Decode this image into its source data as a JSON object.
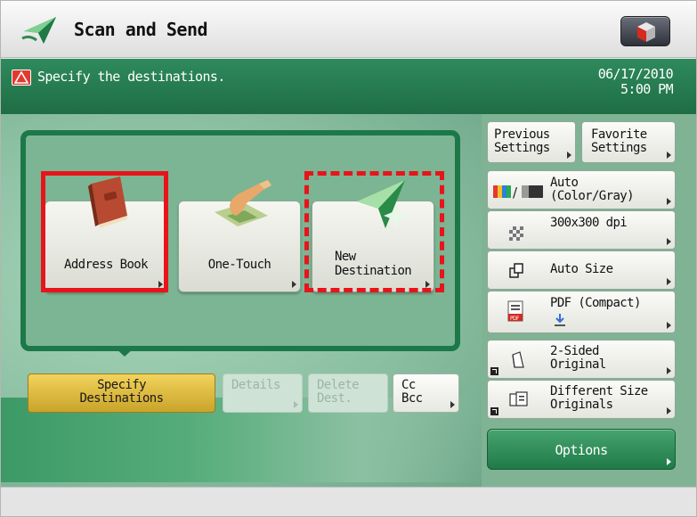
{
  "app": {
    "title": "Scan and Send"
  },
  "status": {
    "message": "Specify the destinations.",
    "date": "06/17/2010",
    "time": "5:00 PM"
  },
  "destinations": [
    {
      "id": "address-book",
      "label": "Address Book",
      "icon": "address-book-icon"
    },
    {
      "id": "one-touch",
      "label": "One-Touch",
      "icon": "one-touch-icon"
    },
    {
      "id": "new-destination",
      "label_line1": "New",
      "label_line2": "Destination",
      "icon": "new-destination-icon"
    }
  ],
  "tabs": {
    "specify": {
      "line1": "Specify",
      "line2": "Destinations"
    },
    "details": {
      "line1": "Details"
    },
    "delete": {
      "line1": "Delete",
      "line2": "Dest."
    },
    "ccbcc": {
      "line1": "Cc",
      "line2": "Bcc"
    }
  },
  "settings": {
    "previous": {
      "line1": "Previous",
      "line2": "Settings"
    },
    "favorite": {
      "line1": "Favorite",
      "line2": "Settings"
    },
    "color": {
      "line1": "Auto",
      "line2": "(Color/Gray)"
    },
    "resolution": {
      "line1": "300x300 dpi"
    },
    "size": {
      "line1": "Auto Size"
    },
    "format": {
      "line1": "PDF (Compact)",
      "icon_text": "PDF"
    },
    "sided": {
      "line1": "2-Sided",
      "line2": "Original"
    },
    "different": {
      "line1": "Different Size",
      "line2": "Originals"
    },
    "options": {
      "label": "Options"
    }
  },
  "colors": {
    "highlight": "#e8141c",
    "panel_green": "#1d7849",
    "tab_active": "#e1bd3f"
  }
}
